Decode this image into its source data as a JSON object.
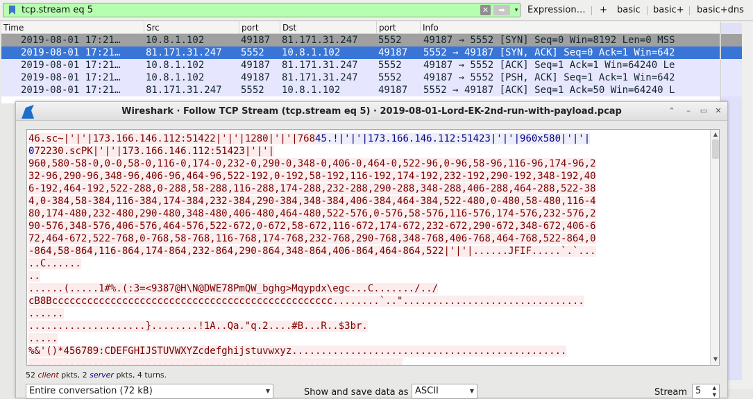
{
  "filter": {
    "value": "tcp.stream eq 5",
    "clear_glyph": "✕",
    "apply_glyph": "➡",
    "dropdown_glyph": "▾"
  },
  "toolbar": {
    "expression_label": "Expression…",
    "plus_label": "+",
    "buttons": [
      "basic",
      "basic+",
      "basic+dns"
    ]
  },
  "packet_list": {
    "columns": [
      "Time",
      "Src",
      "port",
      "Dst",
      "port",
      "Info"
    ],
    "rows": [
      {
        "time": "2019-08-01 17:21…",
        "src": "10.8.1.102",
        "sport": "49187",
        "dst": "81.171.31.247",
        "dport": "5552",
        "info": "49187 → 5552 [SYN] Seq=0 Win=8192 Len=0 MSS"
      },
      {
        "time": "2019-08-01 17:21…",
        "src": "81.171.31.247",
        "sport": "5552",
        "dst": "10.8.1.102",
        "dport": "49187",
        "info": "5552 → 49187 [SYN, ACK] Seq=0 Ack=1 Win=642"
      },
      {
        "time": "2019-08-01 17:21…",
        "src": "10.8.1.102",
        "sport": "49187",
        "dst": "81.171.31.247",
        "dport": "5552",
        "info": "49187 → 5552 [ACK] Seq=1 Ack=1 Win=64240 Le"
      },
      {
        "time": "2019-08-01 17:21…",
        "src": "10.8.1.102",
        "sport": "49187",
        "dst": "81.171.31.247",
        "dport": "5552",
        "info": "49187 → 5552 [PSH, ACK] Seq=1 Ack=1 Win=642"
      },
      {
        "time": "2019-08-01 17:21…",
        "src": "81.171.31.247",
        "sport": "5552",
        "dst": "10.8.1.102",
        "dport": "49187",
        "info": "5552 → 49187 [ACK] Seq=1 Ack=50 Win=64240 L"
      }
    ]
  },
  "dialog": {
    "title": "Wireshark · Follow TCP Stream (tcp.stream eq 5) · 2019-08-01-Lord-EK-2nd-run-with-payload.pcap",
    "stream_lines": [
      [
        {
          "side": "c",
          "t": "46.sc~|'|'|173.166.146.112:51422|'|'|1280|'|'|768"
        },
        {
          "side": "s",
          "t": "45.!|'|'|173.166.146.112:51423|'|'|960x580|'|'|"
        }
      ],
      [
        {
          "side": "s",
          "t": "0"
        },
        {
          "side": "c",
          "t": "72230.scPK|'|'|173.166.146.112:51423|'|'|"
        }
      ],
      [
        {
          "side": "c",
          "t": "960,580-58-0,0-0,58-0,116-0,174-0,232-0,290-0,348-0,406-0,464-0,522-96,0-96,58-96,116-96,174-96,2"
        }
      ],
      [
        {
          "side": "c",
          "t": "32-96,290-96,348-96,406-96,464-96,522-192,0-192,58-192,116-192,174-192,232-192,290-192,348-192,40"
        }
      ],
      [
        {
          "side": "c",
          "t": "6-192,464-192,522-288,0-288,58-288,116-288,174-288,232-288,290-288,348-288,406-288,464-288,522-38"
        }
      ],
      [
        {
          "side": "c",
          "t": "4,0-384,58-384,116-384,174-384,232-384,290-384,348-384,406-384,464-384,522-480,0-480,58-480,116-4"
        }
      ],
      [
        {
          "side": "c",
          "t": "80,174-480,232-480,290-480,348-480,406-480,464-480,522-576,0-576,58-576,116-576,174-576,232-576,2"
        }
      ],
      [
        {
          "side": "c",
          "t": "90-576,348-576,406-576,464-576,522-672,0-672,58-672,116-672,174-672,232-672,290-672,348-672,406-6"
        }
      ],
      [
        {
          "side": "c",
          "t": "72,464-672,522-768,0-768,58-768,116-768,174-768,232-768,290-768,348-768,406-768,464-768,522-864,0"
        }
      ],
      [
        {
          "side": "c",
          "t": "-864,58-864,116-864,174-864,232-864,290-864,348-864,406-864,464-864,522|'|'|......JFIF.....`.`..."
        }
      ],
      [
        {
          "side": "c",
          "t": "..C......"
        }
      ],
      [
        {
          "side": "c",
          "t": ".."
        }
      ],
      [
        {
          "side": "c",
          "t": "......(.....1#%.(:3=<9387@H\\N@DWE78PmQW_bghg>Mqypdx\\egc...C......./../"
        }
      ],
      [
        {
          "side": "c",
          "t": "cB8Bcccccccccccccccccccccccccccccccccccccccccccccccc........`..\"..............................."
        }
      ],
      [
        {
          "side": "c",
          "t": "......"
        }
      ],
      [
        {
          "side": "c",
          "t": "....................}........!1A..Qa.\"q.2....#B...R..$3br."
        }
      ],
      [
        {
          "side": "c",
          "t": "....."
        }
      ],
      [
        {
          "side": "c",
          "t": "%&'()*456789:CDEFGHIJSTUVWXYZcdefghijstuvwxyz..............................................."
        }
      ],
      [
        {
          "side": "c",
          "t": "................................................................"
        }
      ]
    ],
    "stats": {
      "client_count": "52",
      "client_word": "client",
      "pkts1": "pkts,",
      "server_count": "2",
      "server_word": "server",
      "pkts2": "pkts, 4 turns."
    },
    "conversation_select": "Entire conversation (72 kB)",
    "show_label": "Show and save data as",
    "format_select": "ASCII",
    "stream_label": "Stream",
    "stream_value": "5"
  },
  "colors": {
    "filter_bg": "#b7ffb0",
    "selected_row": "#3875d7",
    "client_text": "#7a0000",
    "server_text": "#00007e"
  },
  "icons": [
    "bookmark-icon",
    "clear-icon",
    "apply-arrow-icon",
    "wireshark-fin-icon",
    "up-icon",
    "minimize-icon",
    "maximize-icon",
    "close-icon"
  ]
}
